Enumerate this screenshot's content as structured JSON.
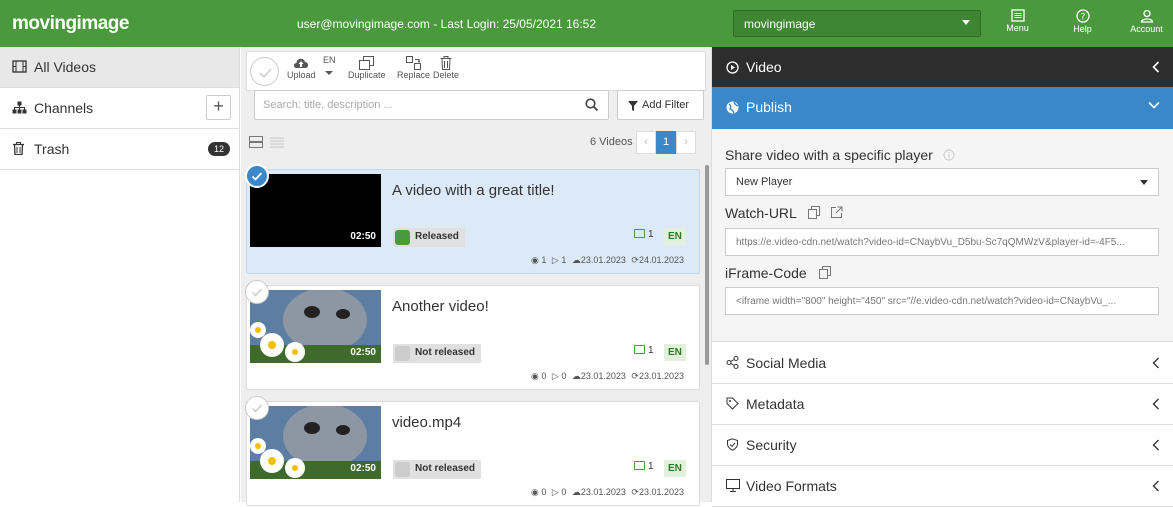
{
  "header": {
    "logo": "movingimage",
    "user_info": "user@movingimage.com - Last Login: 25/05/2021 16:52",
    "org_select": "movingimage",
    "menu_label": "Menu",
    "help_label": "Help",
    "account_label": "Account"
  },
  "sidebar": {
    "items": [
      {
        "label": "All Videos",
        "icon": "film-icon"
      },
      {
        "label": "Channels",
        "icon": "sitemap-icon"
      },
      {
        "label": "Trash",
        "icon": "trash-icon",
        "badge": "12"
      }
    ]
  },
  "toolbar": {
    "upload_label": "Upload",
    "lang_label": "EN",
    "duplicate_label": "Duplicate",
    "replace_label": "Replace",
    "delete_label": "Delete"
  },
  "search": {
    "placeholder": "Search: title, description ...",
    "filter_label": "Add Filter"
  },
  "listing": {
    "count_label": "6 Videos",
    "page": "1"
  },
  "videos": [
    {
      "title": "A video with a great title!",
      "duration": "02:50",
      "status": "Released",
      "subtitles": "1",
      "lang": "EN",
      "views": "1",
      "plays": "1",
      "uploaded": "23.01.2023",
      "modified": "24.01.2023",
      "selected": true
    },
    {
      "title": "Another video!",
      "duration": "02:50",
      "status": "Not released",
      "subtitles": "1",
      "lang": "EN",
      "views": "0",
      "plays": "0",
      "uploaded": "23.01.2023",
      "modified": "23.01.2023",
      "selected": false
    },
    {
      "title": "video.mp4",
      "duration": "02:50",
      "status": "Not released",
      "subtitles": "1",
      "lang": "EN",
      "views": "0",
      "plays": "0",
      "uploaded": "23.01.2023",
      "modified": "23.01.2023",
      "selected": false
    }
  ],
  "panel": {
    "video_header": "Video",
    "publish_header": "Publish",
    "share_label": "Share video with a specific player",
    "player_select": "New Player",
    "watch_url_label": "Watch-URL",
    "watch_url_value": "https://e.video-cdn.net/watch?video-id=CNaybVu_D5bu-Sc7qQMWzV&player-id=-4F5...",
    "iframe_label": "iFrame-Code",
    "iframe_value": "<iframe width=\"800\" height=\"450\" src=\"//e.video-cdn.net/watch?video-id=CNaybVu_...",
    "sections": [
      "Social Media",
      "Metadata",
      "Security",
      "Video Formats"
    ]
  },
  "colors": {
    "brand_green": "#4a9a3d",
    "accent_blue": "#3a87c9",
    "dark_header": "#2d2d2d"
  }
}
